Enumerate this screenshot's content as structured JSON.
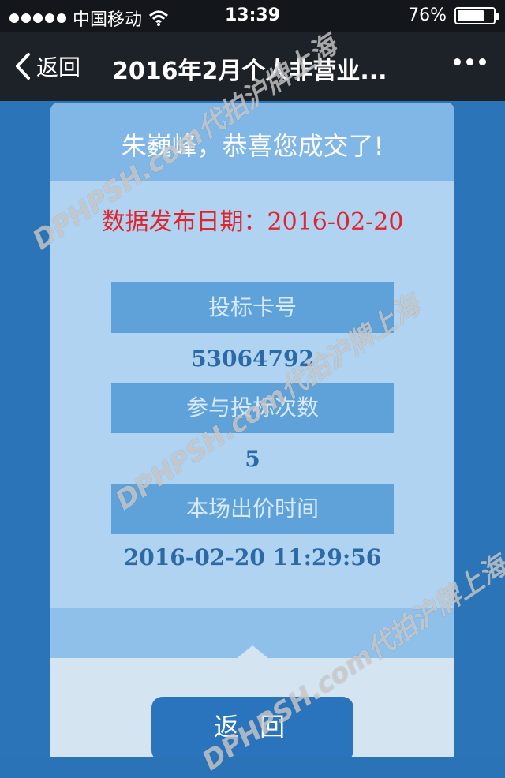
{
  "status_bar": {
    "carrier": "中国移动",
    "time": "13:39",
    "battery": "76%",
    "battery_level": 0.76
  },
  "nav": {
    "back_label": "返回",
    "title": "2016年2月个人非营业..."
  },
  "card": {
    "greeting": "朱巍峰，恭喜您成交了!",
    "date_line": "数据发布日期：2016-02-20",
    "fields": [
      {
        "label": "投标卡号",
        "value": "53064792"
      },
      {
        "label": "参与投标次数",
        "value": "5"
      },
      {
        "label": "本场出价时间",
        "value": "2016-02-20 11:29:56"
      }
    ],
    "return_button": "返 回"
  },
  "watermark": {
    "text": "DPHPSH.com代拍沪牌上海"
  },
  "colors": {
    "date_red": "#e0232c",
    "value_blue": "#2b6aa6",
    "button_blue": "#2a74bd"
  }
}
